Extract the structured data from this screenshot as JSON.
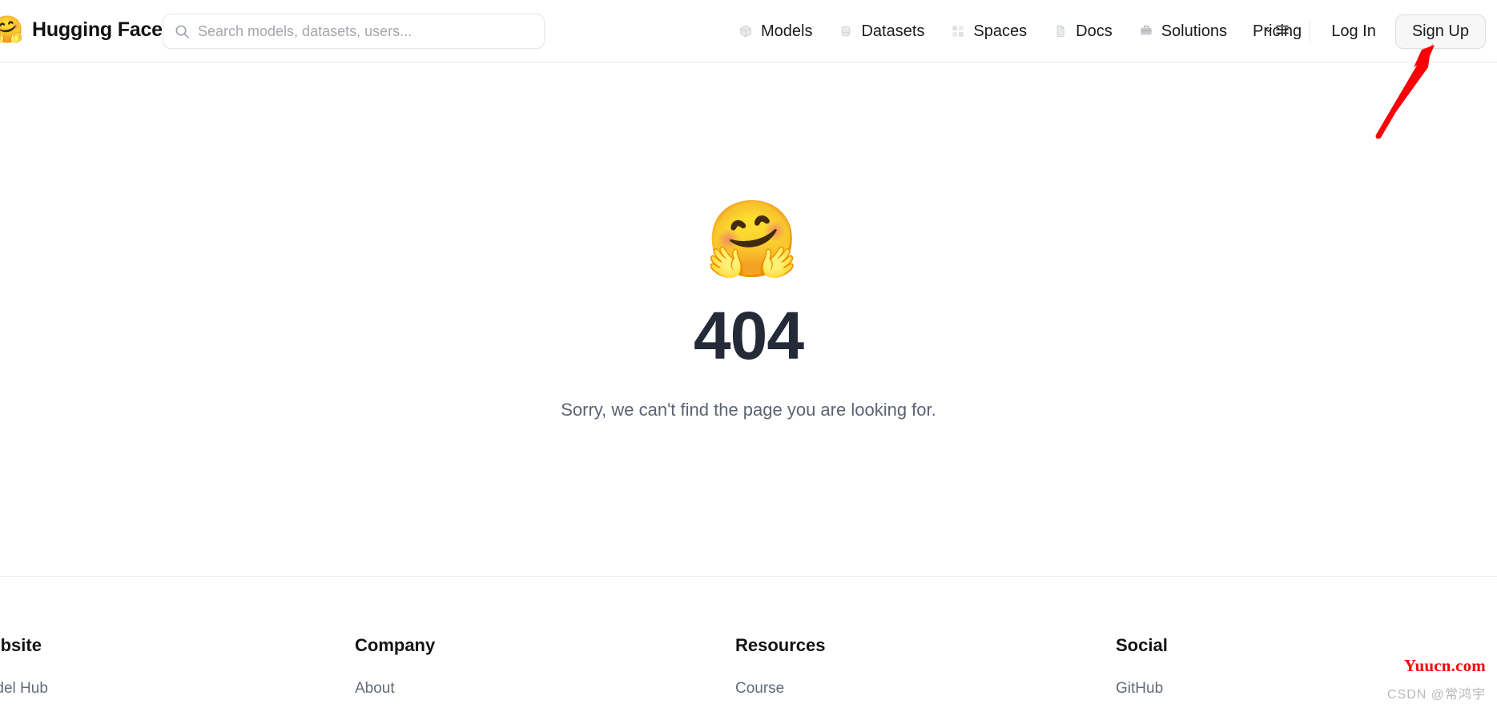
{
  "header": {
    "brand": {
      "logo_icon": "hugging-face-logo",
      "name": "Hugging Face"
    },
    "search": {
      "icon": "search-icon",
      "placeholder": "Search models, datasets, users...",
      "value": ""
    },
    "nav_items": [
      {
        "icon": "cube-icon",
        "label": "Models"
      },
      {
        "icon": "database-icon",
        "label": "Datasets"
      },
      {
        "icon": "grid-apps-icon",
        "label": "Spaces"
      },
      {
        "icon": "document-icon",
        "label": "Docs"
      },
      {
        "icon": "briefcase-icon",
        "label": "Solutions"
      },
      {
        "icon": "",
        "label": "Pricing"
      }
    ],
    "menu_toggle_icon": "chevron-down-hamburger-icon",
    "login_label": "Log In",
    "signup_label": "Sign Up"
  },
  "main": {
    "emoji": "hugging-face-emoji",
    "error_code": "404",
    "error_message": "Sorry, we can't find the page you are looking for."
  },
  "footer": {
    "columns": [
      {
        "title": "Website",
        "links": [
          {
            "label": "Model Hub"
          }
        ]
      },
      {
        "title": "Company",
        "links": [
          {
            "label": "About"
          }
        ]
      },
      {
        "title": "Resources",
        "links": [
          {
            "label": "Course"
          }
        ]
      },
      {
        "title": "Social",
        "links": [
          {
            "label": "GitHub"
          }
        ]
      }
    ]
  },
  "annotation": {
    "arrow_color": "#fb0007",
    "arrow_target": "sign-up-button"
  },
  "watermarks": {
    "site": "Yuucn.com",
    "author": "CSDN @常鸿宇"
  },
  "colors": {
    "error_code": "#242a38",
    "error_message": "#5b6472",
    "accent_red": "#fb0007",
    "border": "#ebebeb",
    "footer_link": "#636c79"
  }
}
